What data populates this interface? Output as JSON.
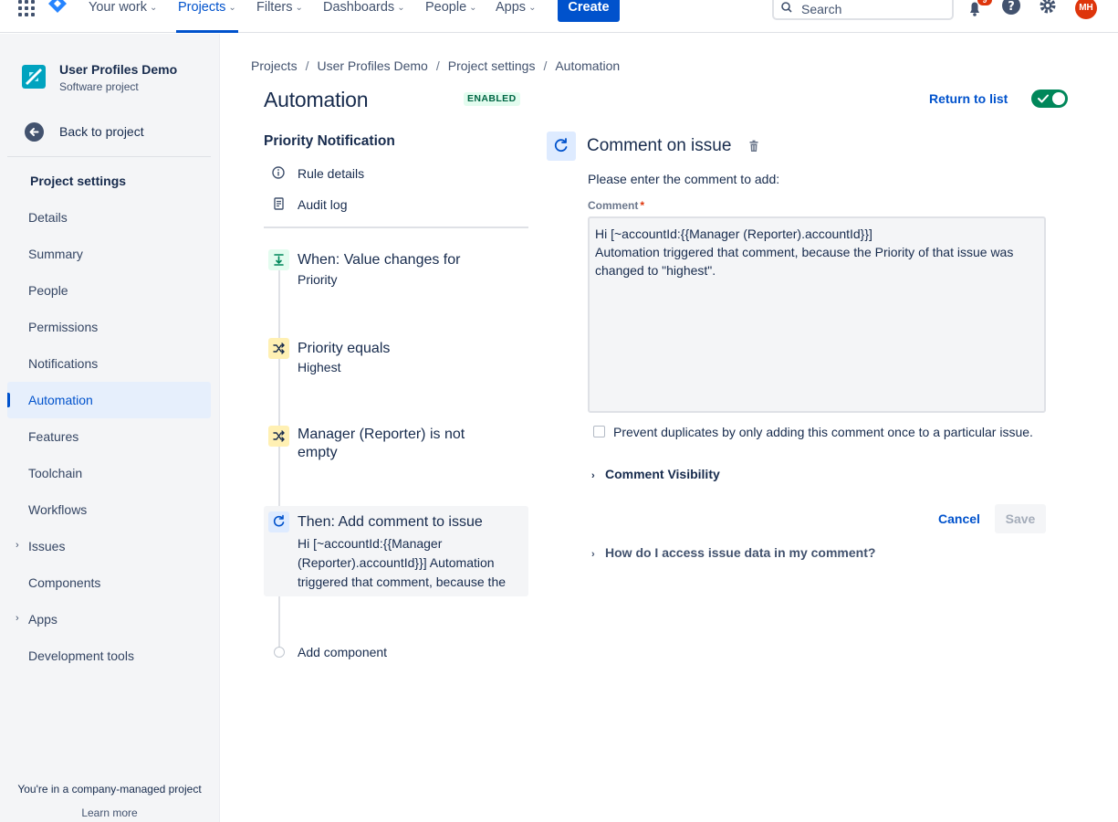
{
  "topnav": {
    "items": [
      {
        "label": "Your work",
        "active": false
      },
      {
        "label": "Projects",
        "active": true
      },
      {
        "label": "Filters",
        "active": false
      },
      {
        "label": "Dashboards",
        "active": false
      },
      {
        "label": "People",
        "active": false
      },
      {
        "label": "Apps",
        "active": false
      }
    ],
    "create_label": "Create",
    "search_placeholder": "Search",
    "notification_count": "9",
    "avatar_initials": "MH",
    "icons": [
      "app-switcher-icon",
      "jira-logo-icon",
      "search-icon",
      "notification-icon",
      "help-icon",
      "settings-icon"
    ]
  },
  "sidebar": {
    "project_name": "User Profiles Demo",
    "project_type": "Software project",
    "back_label": "Back to project",
    "heading": "Project settings",
    "items": [
      {
        "label": "Details",
        "expandable": false,
        "active": false
      },
      {
        "label": "Summary",
        "expandable": false,
        "active": false
      },
      {
        "label": "People",
        "expandable": false,
        "active": false
      },
      {
        "label": "Permissions",
        "expandable": false,
        "active": false
      },
      {
        "label": "Notifications",
        "expandable": false,
        "active": false
      },
      {
        "label": "Automation",
        "expandable": false,
        "active": true
      },
      {
        "label": "Features",
        "expandable": false,
        "active": false
      },
      {
        "label": "Toolchain",
        "expandable": false,
        "active": false
      },
      {
        "label": "Workflows",
        "expandable": false,
        "active": false
      },
      {
        "label": "Issues",
        "expandable": true,
        "active": false
      },
      {
        "label": "Components",
        "expandable": false,
        "active": false
      },
      {
        "label": "Apps",
        "expandable": true,
        "active": false
      },
      {
        "label": "Development tools",
        "expandable": false,
        "active": false
      }
    ],
    "footer_text": "You're in a company-managed project",
    "footer_link": "Learn more"
  },
  "breadcrumb": [
    "Projects",
    "User Profiles Demo",
    "Project settings",
    "Automation"
  ],
  "header": {
    "title": "Automation",
    "status": "ENABLED",
    "return_label": "Return to list",
    "toggle_on": true
  },
  "rule": {
    "name": "Priority Notification",
    "links": [
      {
        "label": "Rule details",
        "icon": "info-icon"
      },
      {
        "label": "Audit log",
        "icon": "document-icon"
      }
    ],
    "components": [
      {
        "title": "When: Value changes for",
        "subtitle": "Priority",
        "kind": "trigger",
        "color": "#e3fcef",
        "icon_color": "#00875a"
      },
      {
        "title": "Priority equals",
        "subtitle": "Highest",
        "kind": "condition",
        "color": "#fff0b3",
        "icon_color": "#172b4d"
      },
      {
        "title": "Manager (Reporter) is not empty",
        "subtitle": "",
        "kind": "condition",
        "color": "#fff0b3",
        "icon_color": "#172b4d"
      },
      {
        "title": "Then: Add comment to issue",
        "subtitle": "Hi [~accountId:{{Manager (Reporter).accountId}}] Automation triggered that comment, because the",
        "kind": "action",
        "color": "#deebff",
        "icon_color": "#0052cc"
      }
    ],
    "add_component_label": "Add component"
  },
  "editor": {
    "title": "Comment on issue",
    "description": "Please enter the comment to add:",
    "field_label": "Comment",
    "required_mark": "*",
    "comment_value": "Hi [~accountId:{{Manager (Reporter).accountId}}]\nAutomation triggered that comment, because the Priority of that issue was changed to \"highest\".",
    "prevent_duplicates_label": "Prevent duplicates by only adding this comment once to a particular issue.",
    "prevent_duplicates_checked": false,
    "visibility_label": "Comment Visibility",
    "cancel_label": "Cancel",
    "save_label": "Save",
    "help_label": "How do I access issue data in my comment?"
  },
  "colors": {
    "brand": "#0052cc",
    "toggle": "#00875a",
    "required": "#de350b"
  }
}
